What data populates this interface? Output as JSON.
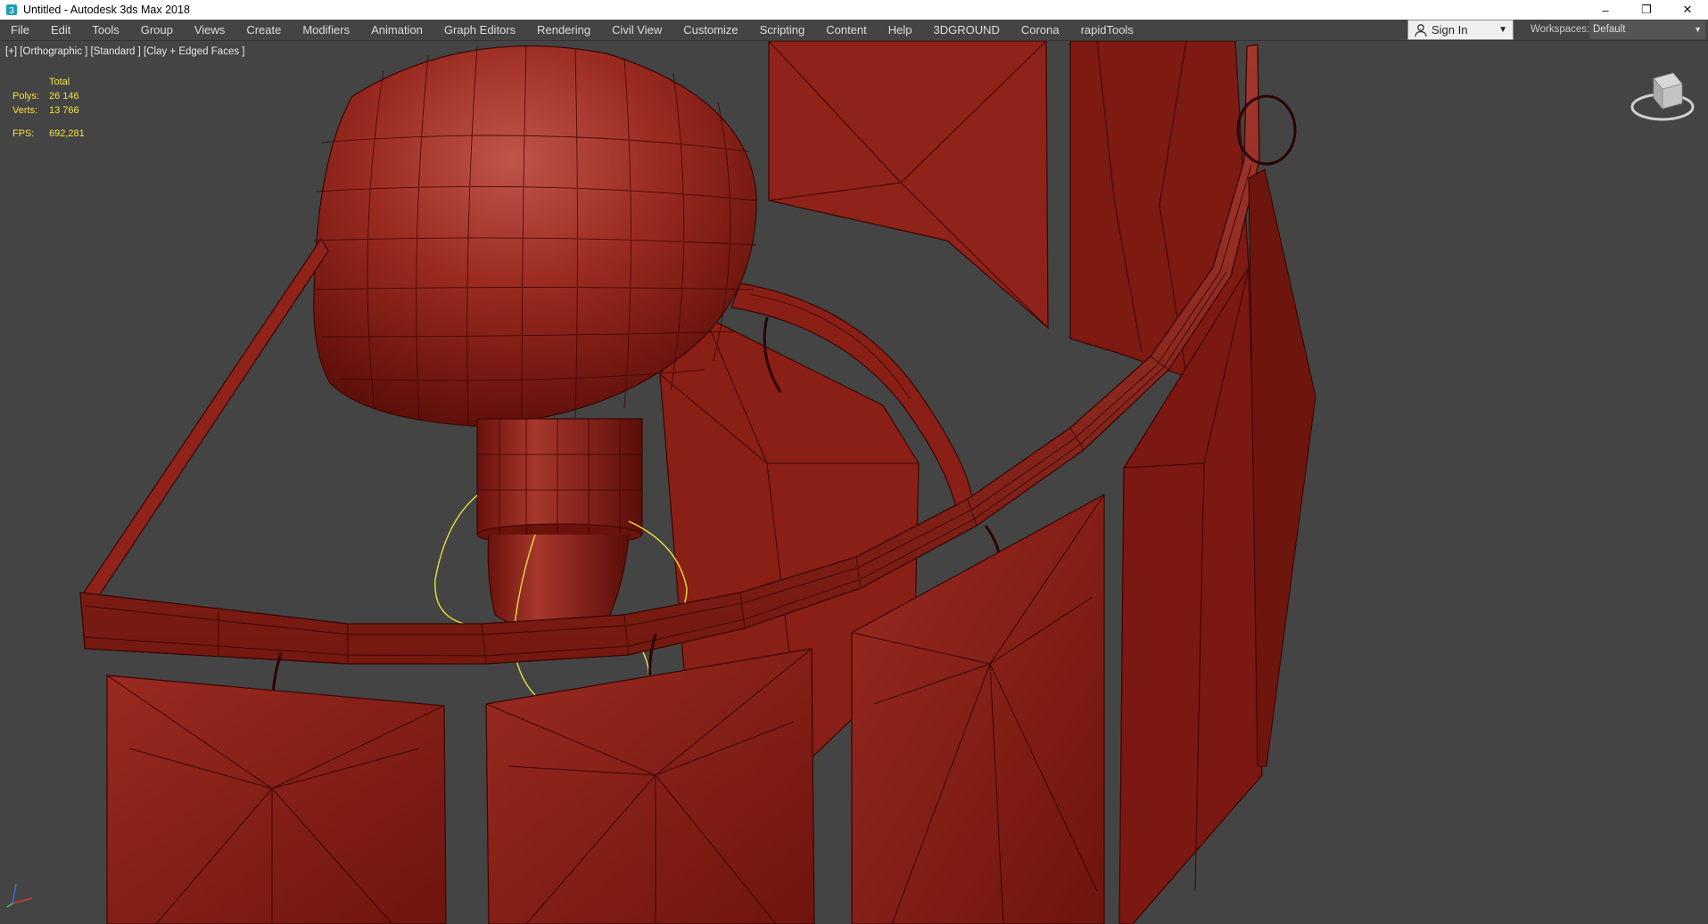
{
  "window": {
    "title": "Untitled - Autodesk 3ds Max 2018",
    "controls": {
      "minimize": "–",
      "restore": "❐",
      "close": "✕"
    }
  },
  "menubar": {
    "items": [
      "File",
      "Edit",
      "Tools",
      "Group",
      "Views",
      "Create",
      "Modifiers",
      "Animation",
      "Graph Editors",
      "Rendering",
      "Civil View",
      "Customize",
      "Scripting",
      "Content",
      "Help",
      "3DGROUND",
      "Corona",
      "rapidTools"
    ]
  },
  "account": {
    "signin_label": "Sign In",
    "caret": "▼"
  },
  "workspaces": {
    "label": "Workspaces:",
    "value": "Default",
    "caret": "▼"
  },
  "viewport": {
    "label": "[+] [Orthographic ] [Standard ] [Clay + Edged Faces ]",
    "stats": {
      "header": "Total",
      "polys_label": "Polys:",
      "polys_value": "26 146",
      "verts_label": "Verts:",
      "verts_value": "13 766",
      "fps_label": "FPS:",
      "fps_value": "692,281"
    },
    "viewcube_icon": "viewcube-icon",
    "axis_icon": "axis-tripod-icon"
  },
  "colors": {
    "mesh": "#8a1c14",
    "mesh_dark": "#5a0e09",
    "mesh_light": "#a8372c",
    "edge": "#3a0603",
    "viewport_bg": "#444444",
    "selection": "#e8e03a",
    "stats_text": "#f4e23a"
  }
}
